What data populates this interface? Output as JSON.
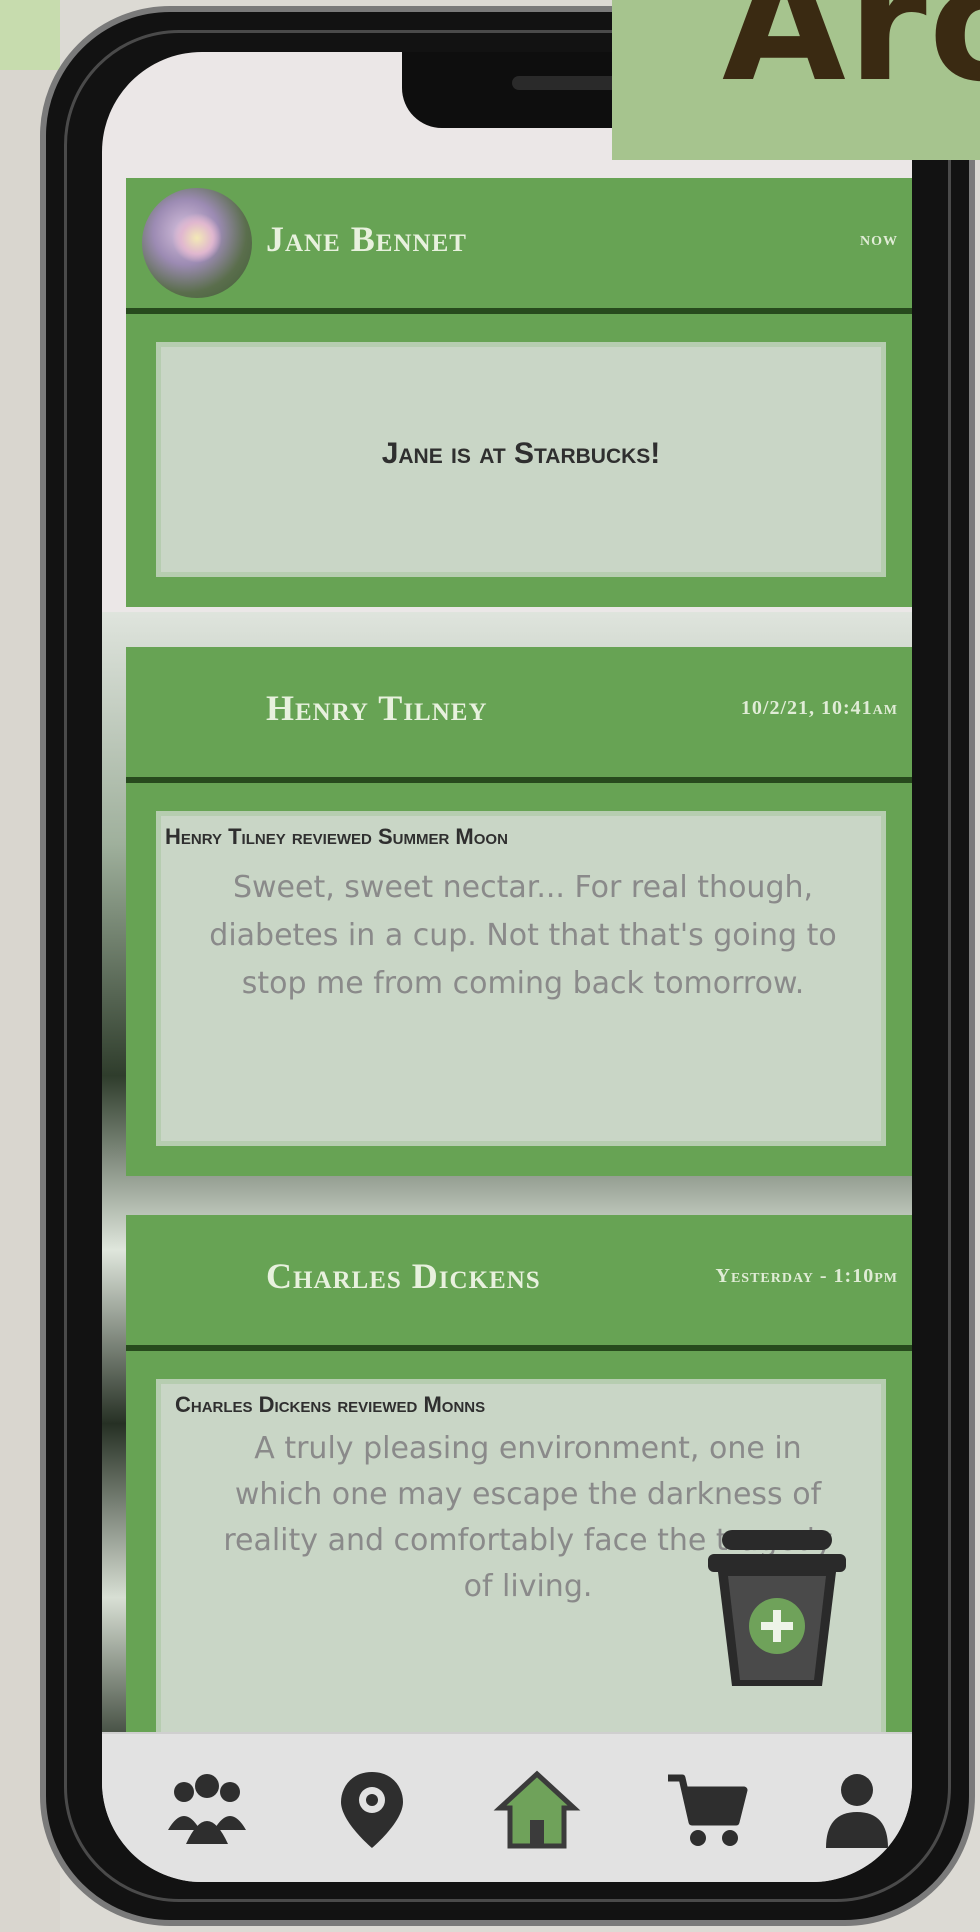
{
  "banner": {
    "text": "Aro"
  },
  "feed": [
    {
      "name": "Jane Bennet",
      "time": "now",
      "status": "Jane is at Starbucks!"
    },
    {
      "name": "Henry Tilney",
      "time": "10/2/21, 10:41am",
      "review_title": "Henry Tilney reviewed Summer Moon",
      "review_text": "Sweet, sweet nectar... For real though, diabetes in a cup. Not that that's going to stop me from coming back tomorrow."
    },
    {
      "name": "Charles Dickens",
      "time": "Yesterday - 1:10pm",
      "review_title": "Charles Dickens reviewed Monns",
      "review_text": "A truly pleasing environment, one in which one may escape the darkness of reality and comfortably face the tragedy of living."
    }
  ],
  "nav": {
    "items": [
      "friends-icon",
      "location-icon",
      "home-icon",
      "cart-icon",
      "profile-icon"
    ],
    "active": "home-icon"
  },
  "colors": {
    "card_green": "#67a354",
    "card_inner": "#c9d6c6",
    "banner": "#a6c48e"
  }
}
